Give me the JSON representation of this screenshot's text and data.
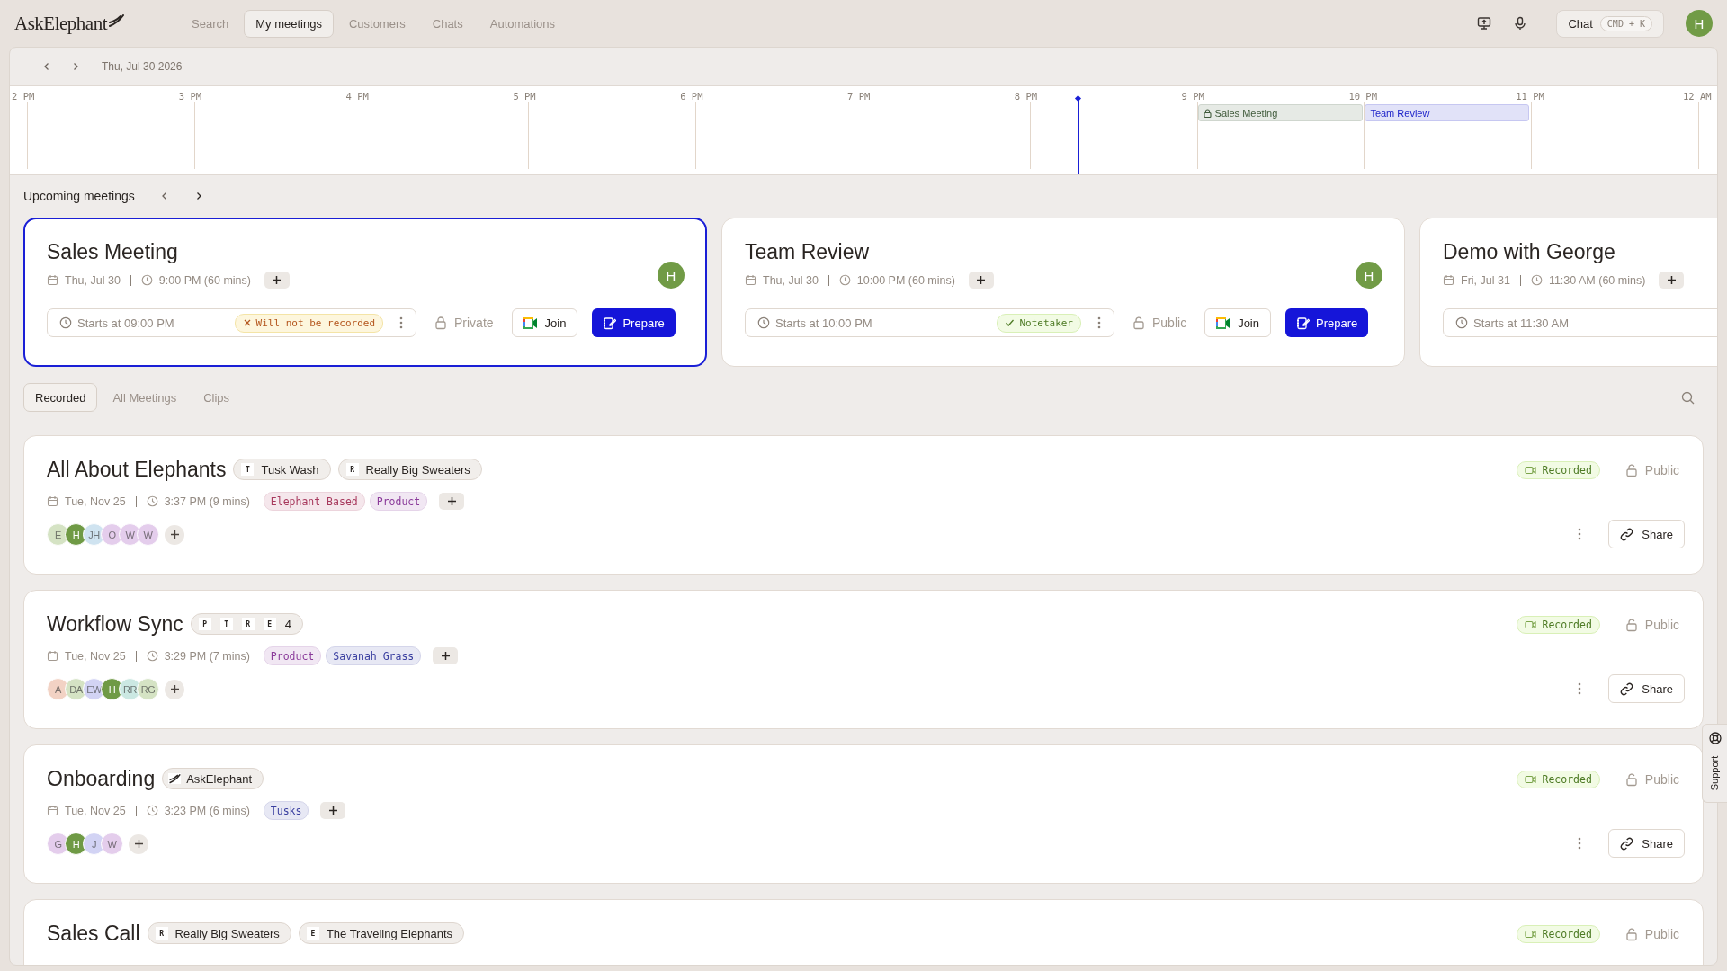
{
  "app": {
    "name": "AskElephant"
  },
  "nav": [
    {
      "label": "Search",
      "selected": false
    },
    {
      "label": "My meetings",
      "selected": true
    },
    {
      "label": "Customers",
      "selected": false
    },
    {
      "label": "Chats",
      "selected": false
    },
    {
      "label": "Automations",
      "selected": false
    }
  ],
  "chat_button": {
    "label": "Chat",
    "shortcut": "CMD + K"
  },
  "user_avatar": {
    "initial": "H"
  },
  "date_bar": {
    "date": "Thu, Jul 30 2026"
  },
  "timeline": {
    "hours": [
      {
        "label": "2 PM"
      },
      {
        "label": "3 PM"
      },
      {
        "label": "4 PM"
      },
      {
        "label": "5 PM"
      },
      {
        "label": "6 PM"
      },
      {
        "label": "7 PM"
      },
      {
        "label": "8 PM",
        "now_marker": true
      },
      {
        "label": "9 PM",
        "events": [
          {
            "title": "Sales Meeting",
            "locked": true,
            "color": "#3f5a3a"
          }
        ]
      },
      {
        "label": "10 PM",
        "events": [
          {
            "title": "Team Review",
            "locked": false,
            "color": "#1a1fc8"
          }
        ]
      },
      {
        "label": "11 PM"
      },
      {
        "label": "12 AM"
      }
    ]
  },
  "upcoming": {
    "title": "Upcoming meetings",
    "meetings": [
      {
        "title": "Sales Meeting",
        "selected": true,
        "date": "Thu, Jul 30",
        "time": "9:00 PM (60 mins)",
        "avatar": "H",
        "starts": "Starts at 09:00 PM",
        "recording": {
          "kind": "off",
          "label": "Will not be recorded"
        },
        "visibility": {
          "kind": "private",
          "label": "Private"
        },
        "join": "Join",
        "prepare": "Prepare"
      },
      {
        "title": "Team Review",
        "selected": false,
        "date": "Thu, Jul 30",
        "time": "10:00 PM (60 mins)",
        "avatar": "H",
        "starts": "Starts at 10:00 PM",
        "recording": {
          "kind": "on",
          "label": "Notetaker"
        },
        "visibility": {
          "kind": "public",
          "label": "Public"
        },
        "join": "Join",
        "prepare": "Prepare"
      },
      {
        "title": "Demo with George",
        "selected": false,
        "date": "Fri, Jul 31",
        "time": "11:30 AM (60 mins)",
        "starts": "Starts at 11:30 AM"
      }
    ]
  },
  "tabs": [
    {
      "label": "Recorded",
      "selected": true
    },
    {
      "label": "All Meetings",
      "selected": false
    },
    {
      "label": "Clips",
      "selected": false
    }
  ],
  "recordings": [
    {
      "title": "All About Elephants",
      "companies": [
        {
          "kind": "single",
          "initial": "T",
          "name": "Tusk Wash"
        },
        {
          "kind": "single",
          "initial": "R",
          "name": "Really Big Sweaters"
        }
      ],
      "date": "Tue, Nov 25",
      "time": "3:37 PM (9 mins)",
      "tags": [
        {
          "label": "Elephant Based",
          "color": "#a83a5e"
        },
        {
          "label": "Product",
          "color": "#8a3a9a"
        }
      ],
      "attendees": [
        {
          "initials": "E",
          "color": "#d5e3c4"
        },
        {
          "initials": "H",
          "color": "#6f9a45"
        },
        {
          "initials": "JH",
          "color": "#cfe3f0"
        },
        {
          "initials": "O",
          "color": "#e4cdec"
        },
        {
          "initials": "W",
          "color": "#e4cdec"
        },
        {
          "initials": "W",
          "color": "#e4cdec"
        }
      ],
      "status": "Recorded",
      "visibility": {
        "kind": "public",
        "label": "Public"
      },
      "share": "Share"
    },
    {
      "title": "Workflow Sync",
      "companies": [
        {
          "kind": "stack",
          "initials": [
            "P",
            "T",
            "R",
            "E"
          ],
          "count": "4"
        }
      ],
      "date": "Tue, Nov 25",
      "time": "3:29 PM (7 mins)",
      "tags": [
        {
          "label": "Product",
          "color": "#8a3a9a"
        },
        {
          "label": "Savanah Grass",
          "color": "#3a3fa0"
        }
      ],
      "attendees": [
        {
          "initials": "A",
          "color": "#f2d2c4"
        },
        {
          "initials": "DA",
          "color": "#d5e3c4"
        },
        {
          "initials": "EW",
          "color": "#d2d3f4"
        },
        {
          "initials": "H",
          "color": "#6f9a45"
        },
        {
          "initials": "RR",
          "color": "#cbe8e2"
        },
        {
          "initials": "RG",
          "color": "#d5e3c4"
        }
      ],
      "status": "Recorded",
      "visibility": {
        "kind": "public",
        "label": "Public"
      },
      "share": "Share"
    },
    {
      "title": "Onboarding",
      "companies": [
        {
          "kind": "logo",
          "name": "AskElephant"
        }
      ],
      "date": "Tue, Nov 25",
      "time": "3:23 PM (6 mins)",
      "tags": [
        {
          "label": "Tusks",
          "color": "#3a3fa0"
        }
      ],
      "attendees": [
        {
          "initials": "G",
          "color": "#e4cdec"
        },
        {
          "initials": "H",
          "color": "#6f9a45"
        },
        {
          "initials": "J",
          "color": "#d2d3f4"
        },
        {
          "initials": "W",
          "color": "#e4cdec"
        }
      ],
      "status": "Recorded",
      "visibility": {
        "kind": "public",
        "label": "Public"
      },
      "share": "Share"
    },
    {
      "title": "Sales Call",
      "companies": [
        {
          "kind": "single",
          "initial": "R",
          "name": "Really Big Sweaters"
        },
        {
          "kind": "single",
          "initial": "E",
          "name": "The Traveling Elephants"
        }
      ],
      "status": "Recorded",
      "visibility": {
        "kind": "public",
        "label": "Public"
      }
    }
  ],
  "support": {
    "label": "Support"
  }
}
